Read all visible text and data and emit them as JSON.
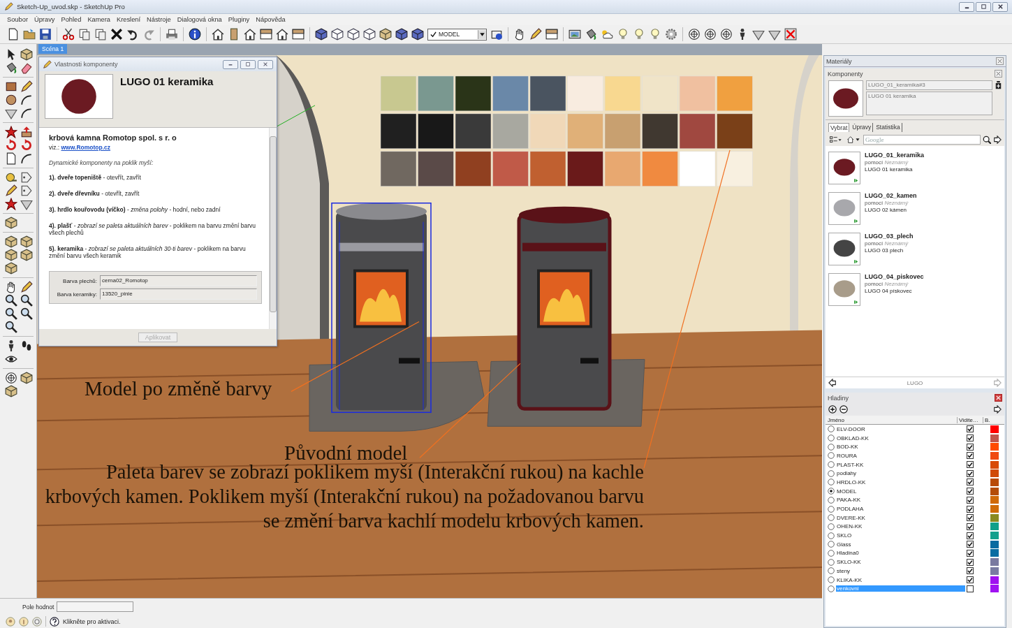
{
  "window": {
    "title": "Sketch-Up_uvod.skp - SketchUp Pro"
  },
  "menu": [
    "Soubor",
    "Úpravy",
    "Pohled",
    "Kamera",
    "Kreslení",
    "Nástroje",
    "Dialogová okna",
    "Pluginy",
    "Nápověda"
  ],
  "toolbar": {
    "layer_select": {
      "value": "MODEL"
    }
  },
  "scene_tabs": [
    {
      "label": "Scéna 1",
      "selected": true
    }
  ],
  "component_dialog": {
    "title": "Vlastnosti komponenty",
    "name": "LUGO 01 keramika",
    "company": "krbová kamna Romotop spol. s r. o",
    "link_prefix": "viz.:",
    "link": "www.Romotop.cz",
    "intro": "Dynamické komponenty na poklik myší:",
    "items": [
      "**1). dveře topeniště** - otevřít, zavřít",
      "**2). dveře dřevníku** - otevřít, zavřít",
      "**3). hrdlo kouřovodu (víčko)** - *změna polohy* - hodní, nebo zadní",
      "**4). plašť** - *zobrazí se paleta aktuálních barev* - poklikem na barvu změní barvu všech plechů",
      "**5). keramika** - *zobrazí se paleta aktuálních 30-ti barev* - poklikem na barvu změní barvu všech keramik"
    ],
    "fields": [
      {
        "label": "Barva plechů:",
        "value": "cerna02_Romotop"
      },
      {
        "label": "Barva keramiky:",
        "value": "13520_pinie"
      }
    ],
    "apply_button": {
      "label": "Aplikovat",
      "disabled": true
    }
  },
  "annotations": {
    "changed_label": "Model po změně barvy",
    "original_label": "Původní model",
    "note": "Paleta barev se zobrazí poklikem myší (Interakční rukou) na kachle krbových kamen. Poklikem myší (Interakční rukou) na požadovanou barvu se změní barva kachlí modelu krbových kamen."
  },
  "value_field": {
    "label": "Pole hodnot"
  },
  "status": {
    "text": "Klikněte pro aktivaci."
  },
  "materials_panel": {
    "title": "Materiály"
  },
  "components_panel": {
    "title": "Komponenty",
    "name": "LUGO_01_keramika#3",
    "description": "LUGO 01 keramika",
    "tabs": [
      {
        "label": "Vybrat",
        "selected": true
      },
      {
        "label": "Úpravy",
        "selected": false
      },
      {
        "label": "Statistika",
        "selected": false
      }
    ],
    "search": {
      "placeholder": "Google"
    },
    "items": [
      {
        "name": "LUGO_01_keramika",
        "by": "pomocí",
        "author": "Neznámý",
        "description": "LUGO 01 keramika",
        "color": "#6b1a22"
      },
      {
        "name": "LUGO_02_kamen",
        "by": "pomocí",
        "author": "Neznámý",
        "description": "LUGO 02 kámen",
        "color": "#a8a8ac"
      },
      {
        "name": "LUGO_03_plech",
        "by": "pomocí",
        "author": "Neznámý",
        "description": "LUGO 03 plech",
        "color": "#444444"
      },
      {
        "name": "LUGO_04_piskovec",
        "by": "pomocí",
        "author": "Neznámý",
        "description": "LUGO 04 pískovec",
        "color": "#a89c8a"
      }
    ],
    "footer": "LUGO"
  },
  "layers_panel": {
    "title": "Hladiny",
    "columns": [
      "Jméno",
      "Vidite…",
      "B."
    ],
    "layers": [
      {
        "name": "ELV-DOOR",
        "current": false,
        "visible": true,
        "selected": false,
        "color": "#ff0000"
      },
      {
        "name": "OBKLAD-KK",
        "current": false,
        "visible": true,
        "selected": false,
        "color": "#c0564d"
      },
      {
        "name": "BOD-KK",
        "current": false,
        "visible": true,
        "selected": false,
        "color": "#ff4a00"
      },
      {
        "name": "ROURA",
        "current": false,
        "visible": true,
        "selected": false,
        "color": "#f04a10"
      },
      {
        "name": "PLAST-KK",
        "current": false,
        "visible": true,
        "selected": false,
        "color": "#d84a08"
      },
      {
        "name": "podlahy",
        "current": false,
        "visible": true,
        "selected": false,
        "color": "#d04a08"
      },
      {
        "name": "HRDLO-KK",
        "current": false,
        "visible": true,
        "selected": false,
        "color": "#b84a08"
      },
      {
        "name": "MODEL",
        "current": true,
        "visible": true,
        "selected": false,
        "color": "#b44c08"
      },
      {
        "name": "PAKA-KK",
        "current": false,
        "visible": true,
        "selected": false,
        "color": "#d06a08"
      },
      {
        "name": "PODLAHA",
        "current": false,
        "visible": true,
        "selected": false,
        "color": "#d06c08"
      },
      {
        "name": "DVERE-KK",
        "current": false,
        "visible": true,
        "selected": false,
        "color": "#8a8a20"
      },
      {
        "name": "OHEN-KK",
        "current": false,
        "visible": true,
        "selected": false,
        "color": "#10a08a"
      },
      {
        "name": "SKLO",
        "current": false,
        "visible": true,
        "selected": false,
        "color": "#12a08c"
      },
      {
        "name": "Glass",
        "current": false,
        "visible": true,
        "selected": false,
        "color": "#0a6aa0"
      },
      {
        "name": "Hladina0",
        "current": false,
        "visible": true,
        "selected": false,
        "color": "#0a6ca2"
      },
      {
        "name": "SKLO-KK",
        "current": false,
        "visible": true,
        "selected": false,
        "color": "#7a7aa0"
      },
      {
        "name": "steny",
        "current": false,
        "visible": true,
        "selected": false,
        "color": "#7a7ca2"
      },
      {
        "name": "KLIKA-KK",
        "current": false,
        "visible": true,
        "selected": false,
        "color": "#a010f0"
      },
      {
        "name": "venkovni",
        "current": false,
        "visible": false,
        "selected": true,
        "color": "#a012f2"
      }
    ]
  }
}
